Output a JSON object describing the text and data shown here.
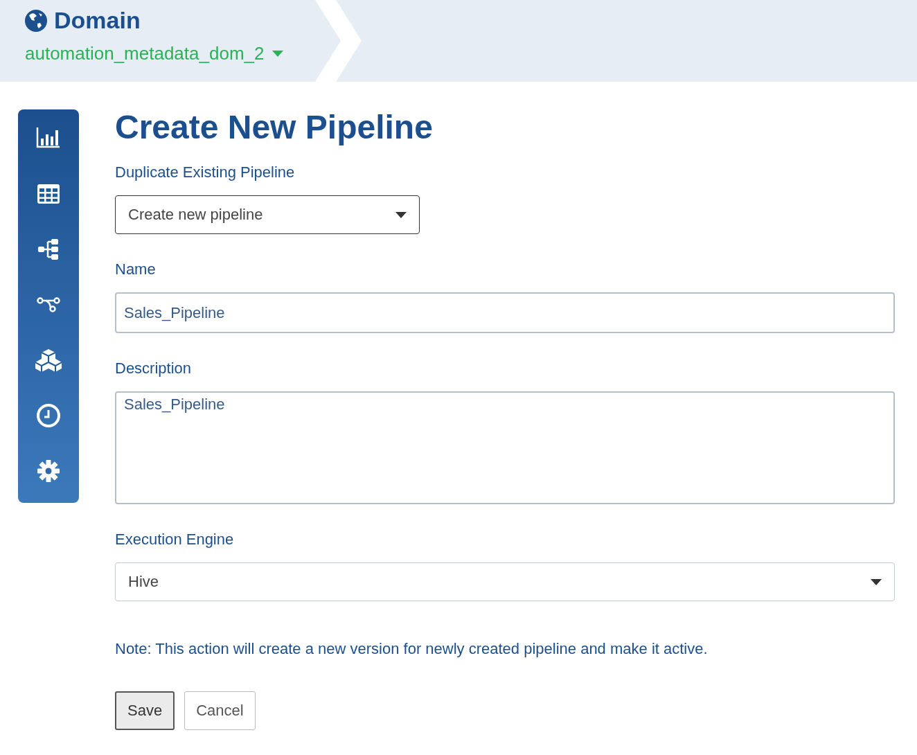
{
  "header": {
    "title": "Domain",
    "domain": "automation_metadata_dom_2"
  },
  "form": {
    "title": "Create New Pipeline",
    "duplicate": {
      "label": "Duplicate Existing Pipeline",
      "value": "Create new pipeline"
    },
    "name": {
      "label": "Name",
      "value": "Sales_Pipeline"
    },
    "description": {
      "label": "Description",
      "value": "Sales_Pipeline"
    },
    "engine": {
      "label": "Execution Engine",
      "value": "Hive"
    },
    "note": "Note: This action will create a new version for newly created pipeline and make it active.",
    "buttons": [
      {
        "label": "Save",
        "kind": "primary"
      },
      {
        "label": "Cancel",
        "kind": "secondary"
      }
    ]
  }
}
